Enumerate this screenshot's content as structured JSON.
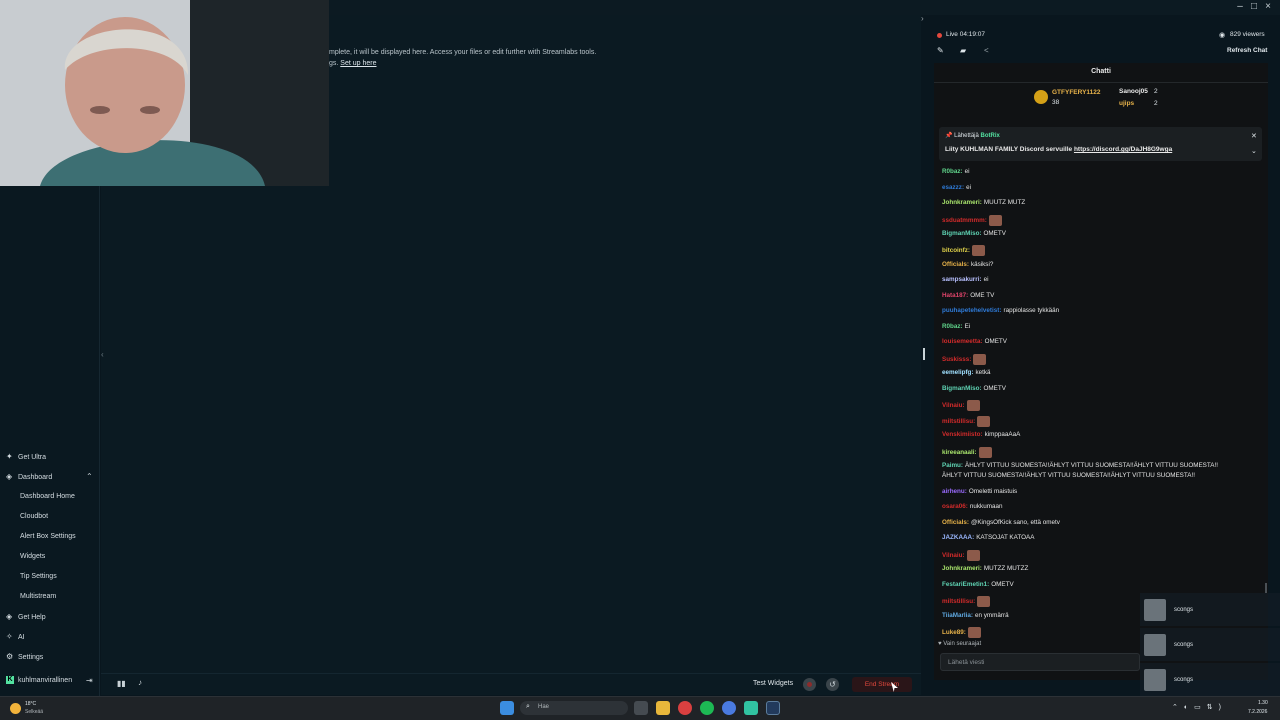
{
  "main_notice": {
    "line1": "mplete, it will be displayed here. Access your files or edit further with Streamlabs tools.",
    "line2": "gs.",
    "link": "Set up here"
  },
  "sidebar": {
    "get_ultra": "Get Ultra",
    "dashboard": "Dashboard",
    "sub": [
      "Dashboard Home",
      "Cloudbot",
      "Alert Box Settings",
      "Widgets",
      "Tip Settings",
      "Multistream"
    ],
    "get_help": "Get Help",
    "ai": "AI",
    "settings": "Settings",
    "account": "kuhlmanvirallinen"
  },
  "bottom": {
    "test_widgets": "Test Widgets",
    "end_stream": "End Stream"
  },
  "stream": {
    "live": "Live 04:19:07",
    "viewers": "829 viewers",
    "refresh": "Refresh Chat"
  },
  "chat": {
    "title": "Chatti",
    "leaderboard": {
      "first_name": "GTFYFERY1122",
      "first_count": "38",
      "second_name": "Sanooj05",
      "second_count": "2",
      "third_name": "ujips",
      "third_count": "2"
    },
    "pinned": {
      "from": "Lähettäjä",
      "bot": "BotRix",
      "text": "Liity KUHLMAN FAMILY Discord servuille ",
      "link": "https://discord.gg/DaJH8G9wga"
    },
    "messages": [
      {
        "user": "R0baz:",
        "msg": "ei",
        "color": "#5fd38a",
        "emote": false
      },
      {
        "user": "esazzz:",
        "msg": "ei",
        "color": "#2f7bd8",
        "emote": false
      },
      {
        "user": "Johnkrameri:",
        "msg": "MUUTZ MUTZ",
        "color": "#a8e36c",
        "emote": false
      },
      {
        "user": "ssduatmmmm:",
        "msg": "",
        "color": "#d22b2b",
        "emote": true
      },
      {
        "user": "BigmanMiso:",
        "msg": "OMETV",
        "color": "#5fd3b3",
        "emote": false
      },
      {
        "user": "bitcoinfz:",
        "msg": "",
        "color": "#e0d24a",
        "emote": true
      },
      {
        "user": "Officials:",
        "msg": "käsiksi?",
        "color": "#e8b34a",
        "emote": false
      },
      {
        "user": "sampsakurri:",
        "msg": "ei",
        "color": "#b8c0ff",
        "emote": false
      },
      {
        "user": "Hata187:",
        "msg": "OME TV",
        "color": "#e0446a",
        "emote": false
      },
      {
        "user": "puuhapetehelvetist:",
        "msg": "rappiolasse tykkään",
        "color": "#2f7bd8",
        "emote": false
      },
      {
        "user": "R0baz:",
        "msg": "Ei",
        "color": "#5fd38a",
        "emote": false
      },
      {
        "user": "louisemeetta:",
        "msg": "OMETV",
        "color": "#d22b2b",
        "emote": false
      },
      {
        "user": "Suskisss:",
        "msg": "",
        "color": "#d22b2b",
        "emote": true
      },
      {
        "user": "eemelipfg:",
        "msg": "ketkä",
        "color": "#a0e0ff",
        "emote": false
      },
      {
        "user": "BigmanMiso:",
        "msg": "OMETV",
        "color": "#5fd3b3",
        "emote": false
      },
      {
        "user": "Vilnaiu:",
        "msg": "",
        "color": "#d22b2b",
        "emote": true
      },
      {
        "user": "miltstillisu:",
        "msg": "",
        "color": "#d22b2b",
        "emote": true
      },
      {
        "user": "Venskimiisto:",
        "msg": "kimppaaAaA",
        "color": "#d22b2b",
        "emote": false
      },
      {
        "user": "kireeanaali:",
        "msg": "",
        "color": "#a8e36c",
        "emote": true
      },
      {
        "user": "Paimu:",
        "msg": "ÄHLYT VITTUU SUOMESTA!!ÄHLYT VITTUU SUOMESTA!!ÄHLYT VITTUU SUOMESTA!!",
        "msg2": "ÄHLYT VITTUU SUOMESTA!!ÄHLYT VITTUU SUOMESTA!!ÄHLYT VITTUU SUOMESTA!!",
        "color": "#5fd3b3",
        "emote": false
      },
      {
        "user": "airhenu:",
        "msg": "Omeletti maistuis",
        "color": "#9b6bff",
        "emote": false
      },
      {
        "user": "osara06:",
        "msg": "nukkumaan",
        "color": "#d22b2b",
        "emote": false
      },
      {
        "user": "Officials:",
        "msg": "@KingsOfKick sano, että ometv",
        "color": "#e8b34a",
        "emote": false
      },
      {
        "user": "JAZKAAA:",
        "msg": "KATSOJAT KATOAA",
        "color": "#9bb8ff",
        "emote": false
      },
      {
        "user": "Vilnaiu:",
        "msg": "",
        "color": "#d22b2b",
        "emote": true
      },
      {
        "user": "Johnkrameri:",
        "msg": "MUTZZ MUTZZ",
        "color": "#a8e36c",
        "emote": false
      },
      {
        "user": "FestariEmetin1:",
        "msg": "OMETV",
        "color": "#5fd3b3",
        "emote": false
      },
      {
        "user": "miltstillisu:",
        "msg": "",
        "color": "#d22b2b",
        "emote": true
      },
      {
        "user": "TiiaMarlia:",
        "msg": "en ymmärrä",
        "color": "#5fa8e0",
        "emote": false
      },
      {
        "user": "Luke89:",
        "msg": "",
        "color": "#e8b34a",
        "emote": true
      }
    ],
    "followers_only": "Vain seuraajat",
    "input_placeholder": "Lähetä viesti"
  },
  "overlay": {
    "items": [
      "scongs",
      "scongs",
      "scongs"
    ]
  },
  "taskbar": {
    "weather": "18°C",
    "weather_sub": "Selkeää",
    "search": "Hae",
    "time": "1.30",
    "date": "7.2.2026"
  },
  "colors": {
    "accent": "#53e2a1",
    "live": "#e3483d",
    "end_stream": "#e3483d"
  }
}
